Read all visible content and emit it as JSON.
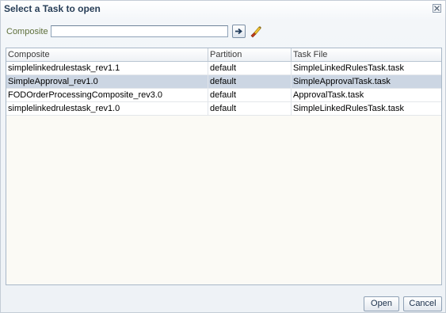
{
  "dialog": {
    "title": "Select a Task to open"
  },
  "filter": {
    "label": "Composite",
    "value": "",
    "placeholder": ""
  },
  "table": {
    "columns": [
      "Composite",
      "Partition",
      "Task File"
    ],
    "rows": [
      {
        "composite": "simplelinkedrulestask_rev1.1",
        "partition": "default",
        "task_file": "SimpleLinkedRulesTask.task",
        "selected": false
      },
      {
        "composite": "SimpleApproval_rev1.0",
        "partition": "default",
        "task_file": "SimpleApprovalTask.task",
        "selected": true
      },
      {
        "composite": "FODOrderProcessingComposite_rev3.0",
        "partition": "default",
        "task_file": "ApprovalTask.task",
        "selected": false
      },
      {
        "composite": "simplelinkedrulestask_rev1.0",
        "partition": "default",
        "task_file": "SimpleLinkedRulesTask.task",
        "selected": false
      }
    ]
  },
  "buttons": {
    "open": "Open",
    "cancel": "Cancel"
  },
  "icons": {
    "close": "close-icon",
    "go": "arrow-right-icon",
    "clear": "eraser-icon"
  },
  "colors": {
    "title": "#283e57",
    "label": "#5e6f3a",
    "selected_row": "#ccd6e3"
  }
}
